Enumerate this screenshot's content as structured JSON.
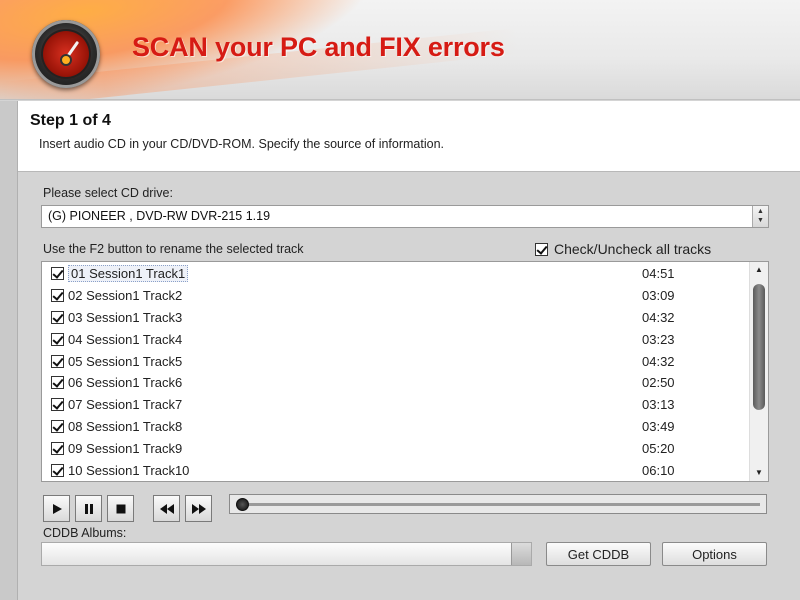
{
  "banner": {
    "title": "SCAN your PC and FIX errors"
  },
  "step": {
    "title": "Step 1 of 4",
    "description": "Insert audio CD in your CD/DVD-ROM. Specify the source of information."
  },
  "drive": {
    "label": "Please select CD drive:",
    "selected": "(G) PIONEER , DVD-RW  DVR-215   1.19"
  },
  "tracks": {
    "hint": "Use the F2 button to rename the selected track",
    "check_all_label": "Check/Uncheck all tracks",
    "check_all_checked": true,
    "items": [
      {
        "name": "01 Session1 Track1",
        "duration": "04:51",
        "checked": true,
        "selected": true
      },
      {
        "name": "02 Session1 Track2",
        "duration": "03:09",
        "checked": true
      },
      {
        "name": "03 Session1 Track3",
        "duration": "04:32",
        "checked": true
      },
      {
        "name": "04 Session1 Track4",
        "duration": "03:23",
        "checked": true
      },
      {
        "name": "05 Session1 Track5",
        "duration": "04:32",
        "checked": true
      },
      {
        "name": "06 Session1 Track6",
        "duration": "02:50",
        "checked": true
      },
      {
        "name": "07 Session1 Track7",
        "duration": "03:13",
        "checked": true
      },
      {
        "name": "08 Session1 Track8",
        "duration": "03:49",
        "checked": true
      },
      {
        "name": "09 Session1 Track9",
        "duration": "05:20",
        "checked": true
      },
      {
        "name": "10 Session1 Track10",
        "duration": "06:10",
        "checked": true
      }
    ]
  },
  "player": {
    "play_icon": "play-icon",
    "pause_icon": "pause-icon",
    "stop_icon": "stop-icon",
    "rewind_icon": "rewind-icon",
    "forward_icon": "fast-forward-icon",
    "seek_position": 0
  },
  "cddb": {
    "label": "CDDB Albums:",
    "value": "",
    "get_button": "Get CDDB",
    "options_button": "Options"
  },
  "colors": {
    "banner_title": "#d61b14",
    "accent_orange": "#ff9a3c"
  }
}
